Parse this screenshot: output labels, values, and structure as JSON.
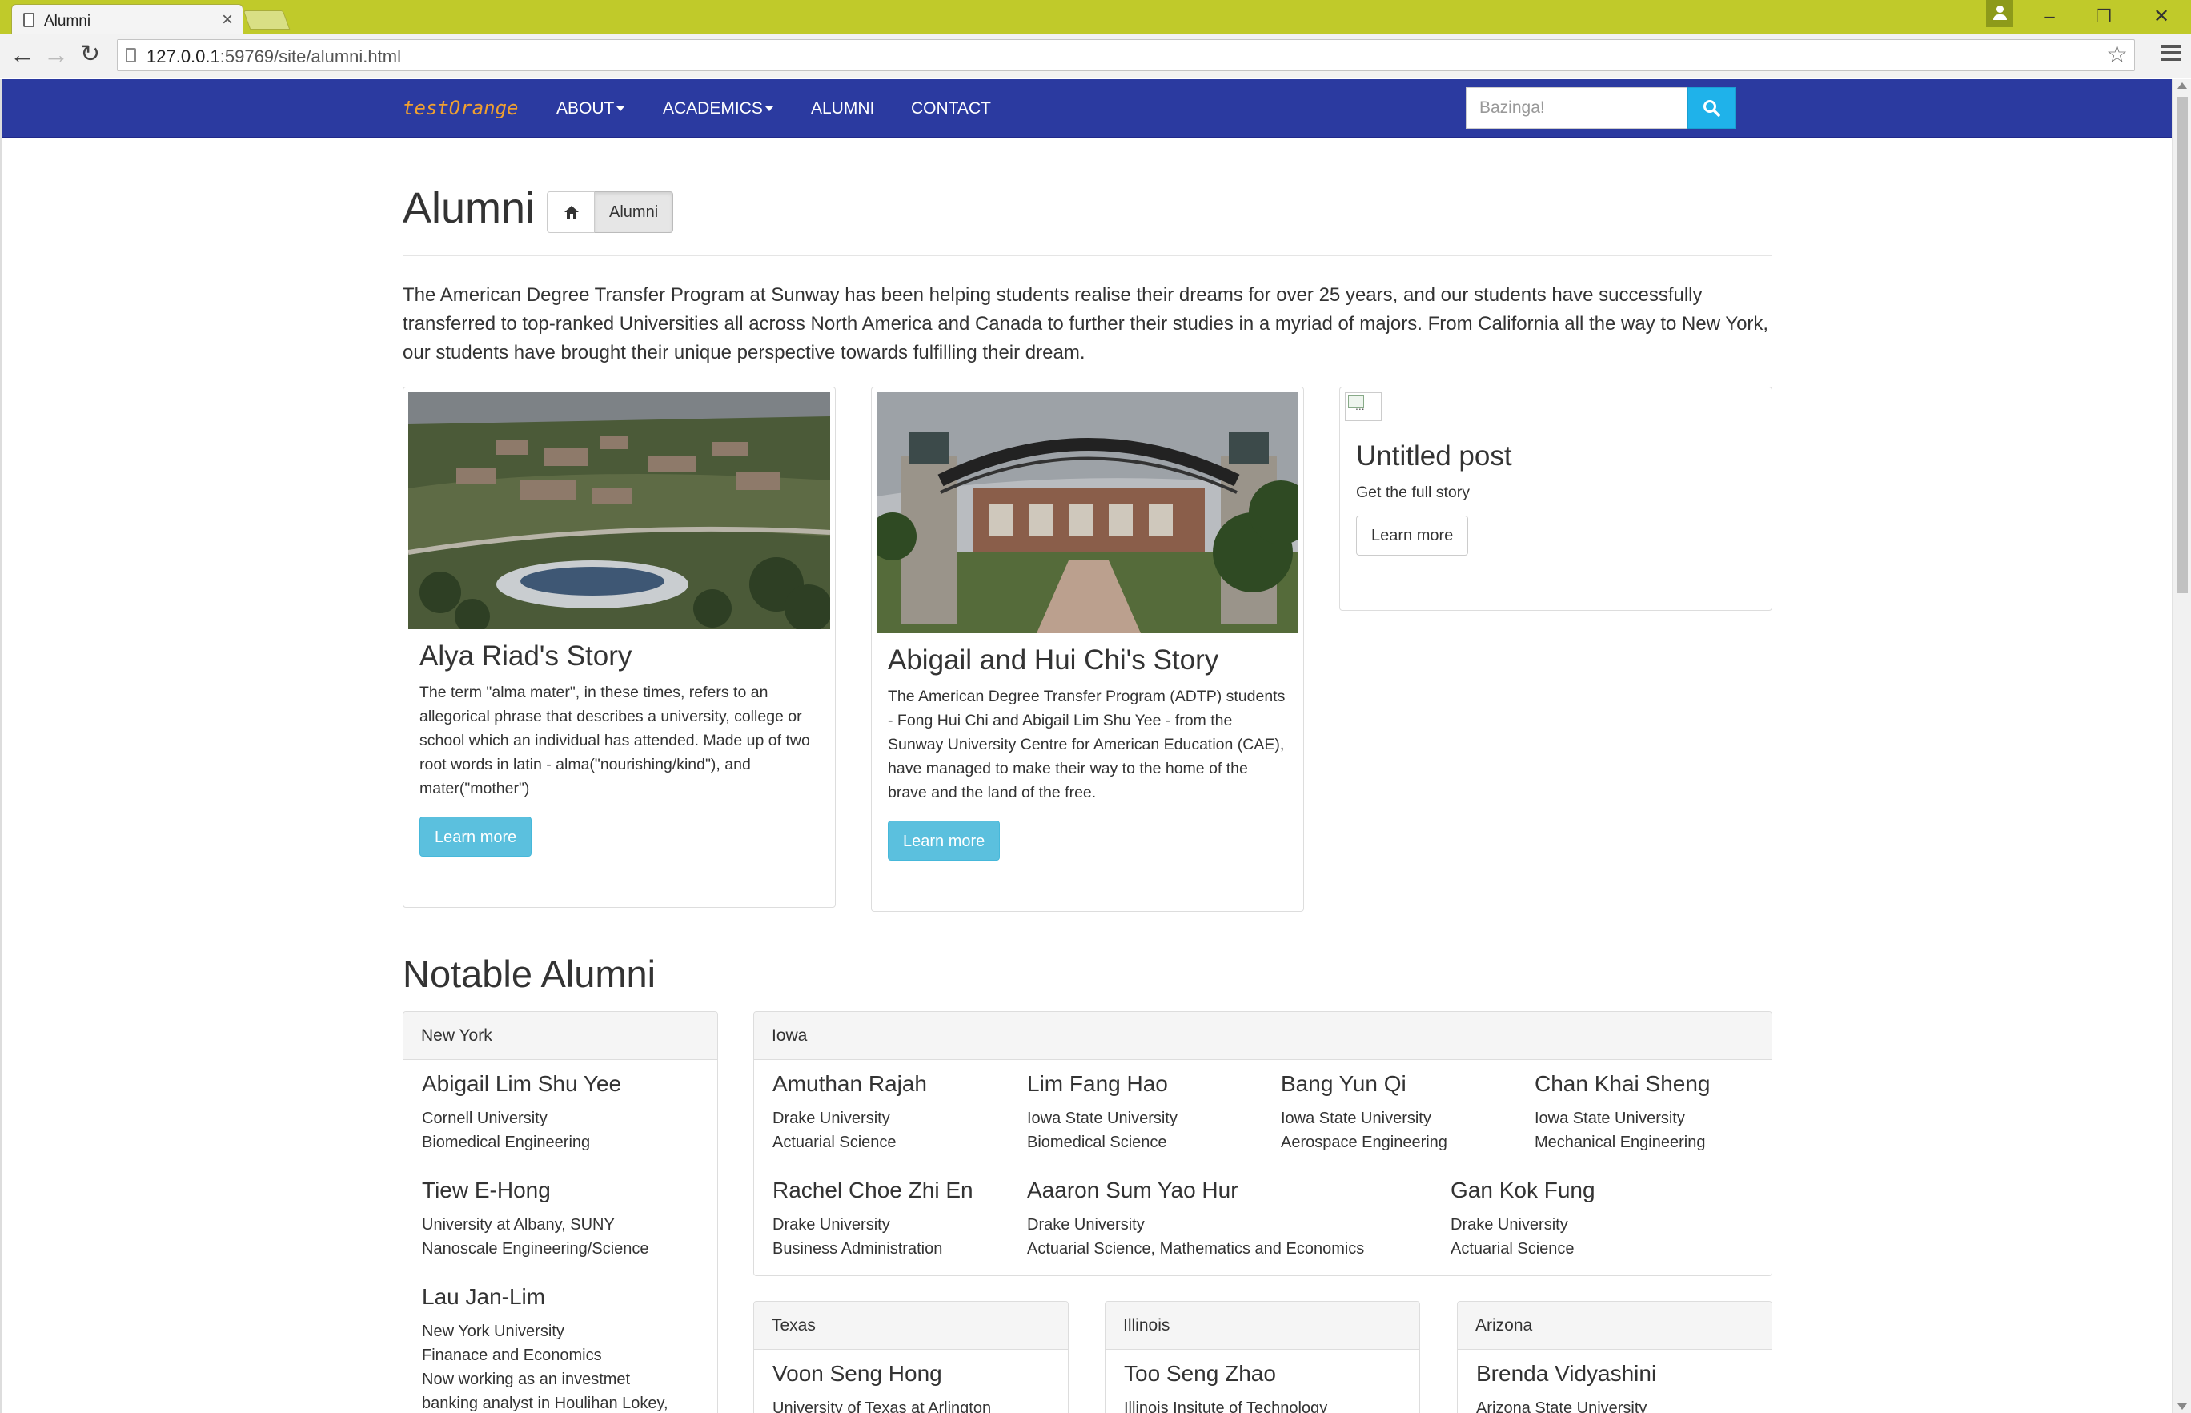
{
  "browser": {
    "tab_title": "Alumni",
    "url_host": "127.0.0.1",
    "url_path": ":59769/site/alumni.html"
  },
  "navbar": {
    "brand": "testOrange",
    "links": [
      "ABOUT",
      "ACADEMICS",
      "ALUMNI",
      "CONTACT"
    ],
    "search_placeholder": "Bazinga!"
  },
  "header": {
    "title": "Alumni",
    "breadcrumb_active": "Alumni"
  },
  "intro": "The American Degree Transfer Program at Sunway has been helping students realise their dreams for over 25 years, and our students have successfully transferred to top-ranked Universities all across North America and Canada to further their studies in a myriad of majors. From California all the way to New York, our students have brought their unique perspective towards fulfilling their dream.",
  "stories": [
    {
      "title": "Alya Riad's Story",
      "body": "The term \"alma mater\", in these times, refers to an allegorical phrase that describes a university, college or school which an individual has attended. Made up of two root words in latin - alma(\"nourishing/kind\"), and mater(\"mother\")",
      "button": "Learn more"
    },
    {
      "title": "Abigail and Hui Chi's Story",
      "body": "The American Degree Transfer Program (ADTP) students - Fong Hui Chi and Abigail Lim Shu Yee - from the Sunway University Centre for American Education (CAE), have managed to make their way to the home of the brave and the land of the free.",
      "button": "Learn more"
    },
    {
      "image_alt": "...",
      "title": "Untitled post",
      "body": "Get the full story",
      "button": "Learn more"
    }
  ],
  "notable": {
    "title": "Notable Alumni",
    "new_york": {
      "heading": "New York",
      "people": [
        {
          "name": "Abigail Lim Shu Yee",
          "lines": [
            "Cornell University",
            "Biomedical Engineering"
          ]
        },
        {
          "name": "Tiew E-Hong",
          "lines": [
            "University at Albany, SUNY",
            "Nanoscale Engineering/Science"
          ]
        },
        {
          "name": "Lau Jan-Lim",
          "lines": [
            "New York University",
            "Finanace and Economics",
            "Now working as an investmet",
            "banking analyst in Houlihan Lokey,"
          ]
        }
      ]
    },
    "iowa": {
      "heading": "Iowa",
      "people": [
        {
          "name": "Amuthan Rajah",
          "lines": [
            "Drake University",
            "Actuarial Science"
          ]
        },
        {
          "name": "Lim Fang Hao",
          "lines": [
            "Iowa State University",
            "Biomedical Science"
          ]
        },
        {
          "name": "Bang Yun Qi",
          "lines": [
            "Iowa State University",
            "Aerospace Engineering"
          ]
        },
        {
          "name": "Chan Khai Sheng",
          "lines": [
            "Iowa State University",
            "Mechanical Engineering"
          ]
        },
        {
          "name": "Rachel Choe Zhi En",
          "lines": [
            "Drake University",
            "Business Administration"
          ]
        },
        {
          "name": "Aaaron Sum Yao Hur",
          "lines": [
            "Drake University",
            "Actuarial Science, Mathematics and Economics"
          ]
        },
        {
          "name": "Gan Kok Fung",
          "lines": [
            "Drake University",
            "Actuarial Science"
          ]
        }
      ]
    },
    "texas": {
      "heading": "Texas",
      "people": [
        {
          "name": "Voon Seng Hong",
          "lines": [
            "University of Texas at Arlington"
          ]
        }
      ]
    },
    "illinois": {
      "heading": "Illinois",
      "people": [
        {
          "name": "Too Seng Zhao",
          "lines": [
            "Illinois Insitute of Technology"
          ]
        }
      ]
    },
    "arizona": {
      "heading": "Arizona",
      "people": [
        {
          "name": "Brenda Vidyashini",
          "lines": [
            "Arizona State University"
          ]
        }
      ]
    }
  },
  "colors": {
    "navbar": "#2b3aa0",
    "brand": "#f0a030",
    "search_button": "#1fb2ea",
    "info_button": "#5bc0de",
    "titlebar": "#c0ca2a"
  }
}
